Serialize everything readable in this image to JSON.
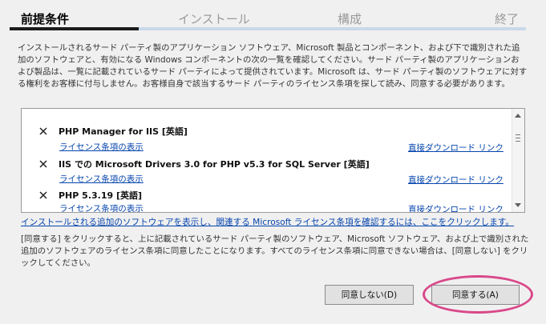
{
  "steps": {
    "prerequisites": "前提条件",
    "install": "インストール",
    "configure": "構成",
    "finish": "終了"
  },
  "progress_fraction": 0.25,
  "intro_text": "インストールされるサード パーティ製のアプリケーション ソフトウェア、Microsoft 製品とコンポーネント、および下で識別された追加のソフトウェアと、有効になる Windows コンポーネントの次の一覧を確認してください。サード パーティ製のアプリケーションおよび製品は、一覧に記載されているサード パーティによって提供されています。Microsoft は、サード パーティ製のソフトウェアに対する権利をお客様に付与しません。お客様自身で該当するサード パーティのライセンス条項を探して読み、同意する必要があります。",
  "items": [
    {
      "title": "PHP Manager for IIS [英語]",
      "license_link": "ライセンス条項の表示",
      "download_link": "直接ダウンロード リンク"
    },
    {
      "title": "IIS での Microsoft Drivers 3.0 for PHP v5.3 for SQL Server [英語]",
      "license_link": "ライセンス条項の表示",
      "download_link": "直接ダウンロード リンク"
    },
    {
      "title": "PHP 5.3.19 [英語]",
      "license_link": "ライセンス条項の表示",
      "download_link": "直接ダウンロード リンク"
    }
  ],
  "more_link": "インストールされる追加のソフトウェアを表示し、関連する Microsoft ライセンス条項を確認するには、ここをクリックします。",
  "footer_text": "[同意する] をクリックすると、上に記載されているサード パーティ製のソフトウェア、Microsoft ソフトウェア、および上で識別された追加のソフトウェアのライセンス条項に同意したことになります。すべてのライセンス条項に同意できない場合は、[同意しない] をクリックしてください。",
  "buttons": {
    "decline": "同意しない(D)",
    "accept": "同意する(A)"
  },
  "colors": {
    "link": "#0645ad",
    "progress_track": "#c9d8ea",
    "progress_fill": "#1b1b1b",
    "highlight": "#d9488a"
  }
}
